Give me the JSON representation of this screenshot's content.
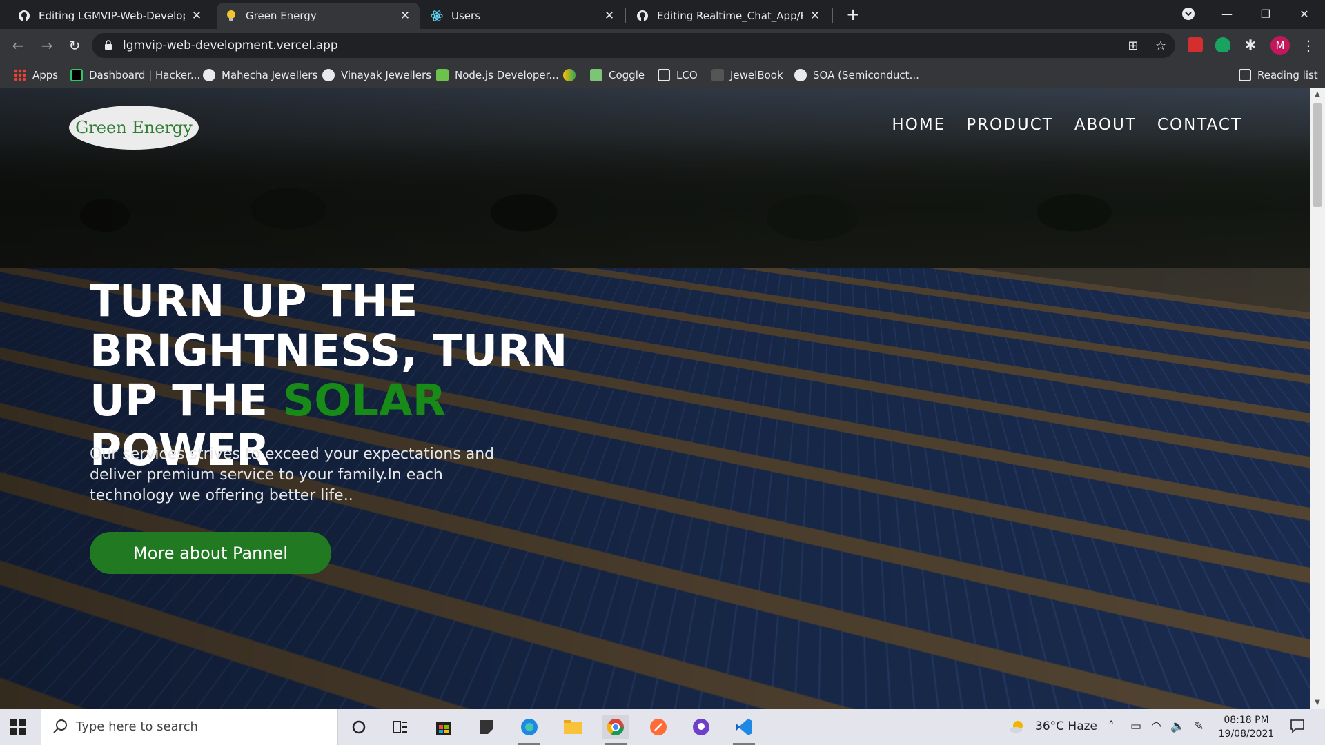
{
  "browser": {
    "tabs": [
      {
        "title": "Editing LGMVIP-Web-Developme",
        "icon": "github-icon",
        "active": false
      },
      {
        "title": "Green Energy",
        "icon": "lightbulb-icon",
        "active": true
      },
      {
        "title": "Users",
        "icon": "react-icon",
        "active": false
      },
      {
        "title": "Editing Realtime_Chat_App/READ",
        "icon": "github-icon",
        "active": false
      }
    ],
    "url": "lgmvip-web-development.vercel.app",
    "profile_initial": "M",
    "bookmarks": [
      {
        "label": "Apps",
        "icon": "apps-grid-icon"
      },
      {
        "label": "Dashboard | Hacker...",
        "icon": "hackerrank-icon"
      },
      {
        "label": "Mahecha Jewellers",
        "icon": "globe-icon"
      },
      {
        "label": "Vinayak Jewellers",
        "icon": "globe-icon"
      },
      {
        "label": "Node.js Developer...",
        "icon": "nodejs-icon"
      },
      {
        "label": "",
        "icon": "bookmark-icon"
      },
      {
        "label": "Coggle",
        "icon": "coggle-icon"
      },
      {
        "label": "LCO",
        "icon": "lco-icon"
      },
      {
        "label": "JewelBook",
        "icon": "jewelbook-icon"
      },
      {
        "label": "SOA (Semiconduct...",
        "icon": "globe-icon"
      }
    ],
    "reading_list": "Reading list"
  },
  "page": {
    "logo": "Green Energy",
    "nav": [
      "HOME",
      "PRODUCT",
      "ABOUT",
      "CONTACT"
    ],
    "headline_part1": "TURN UP THE BRIGHTNESS, TURN UP THE ",
    "headline_accent": "SOLAR",
    "headline_part2": " POWER",
    "subtext": "Our services strives to exceed your expectations and deliver premium service to your family.In each technology we offering better life..",
    "cta": "More about Pannel",
    "colors": {
      "accent": "#178a17",
      "button": "#217a21",
      "logo_text": "#2e7d32"
    }
  },
  "taskbar": {
    "search_placeholder": "Type here to search",
    "weather": "36°C  Haze",
    "time": "08:18 PM",
    "date": "19/08/2021"
  }
}
